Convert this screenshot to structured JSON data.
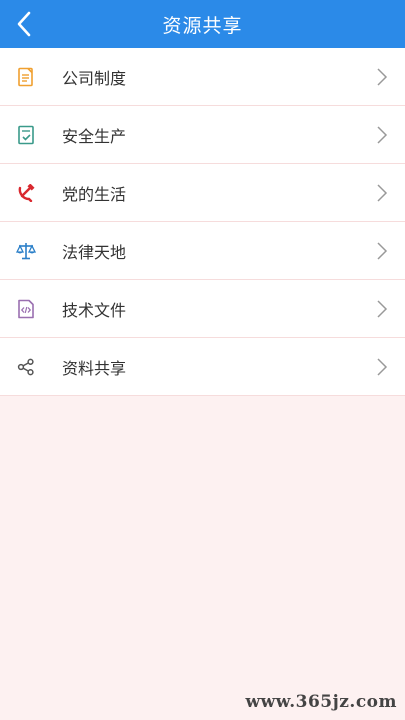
{
  "header": {
    "title": "资源共享",
    "back_icon": "chevron-left-icon"
  },
  "items": [
    {
      "label": "公司制度",
      "icon": "document-icon"
    },
    {
      "label": "安全生产",
      "icon": "checklist-icon"
    },
    {
      "label": "党的生活",
      "icon": "hammer-sickle-icon"
    },
    {
      "label": "法律天地",
      "icon": "scale-icon"
    },
    {
      "label": "技术文件",
      "icon": "code-file-icon"
    },
    {
      "label": "资料共享",
      "icon": "share-icon"
    }
  ],
  "watermark": "www.365jz.com",
  "colors": {
    "header_bg": "#2b8ae8",
    "page_bg": "#fdf1f1",
    "document_icon": "#f0a030",
    "checklist_icon": "#3a9a8a",
    "party_icon": "#d9282f",
    "scale_icon": "#2b7fc8",
    "code_file_icon": "#9a6fb0",
    "share_icon": "#555555",
    "arrow": "#999999"
  }
}
